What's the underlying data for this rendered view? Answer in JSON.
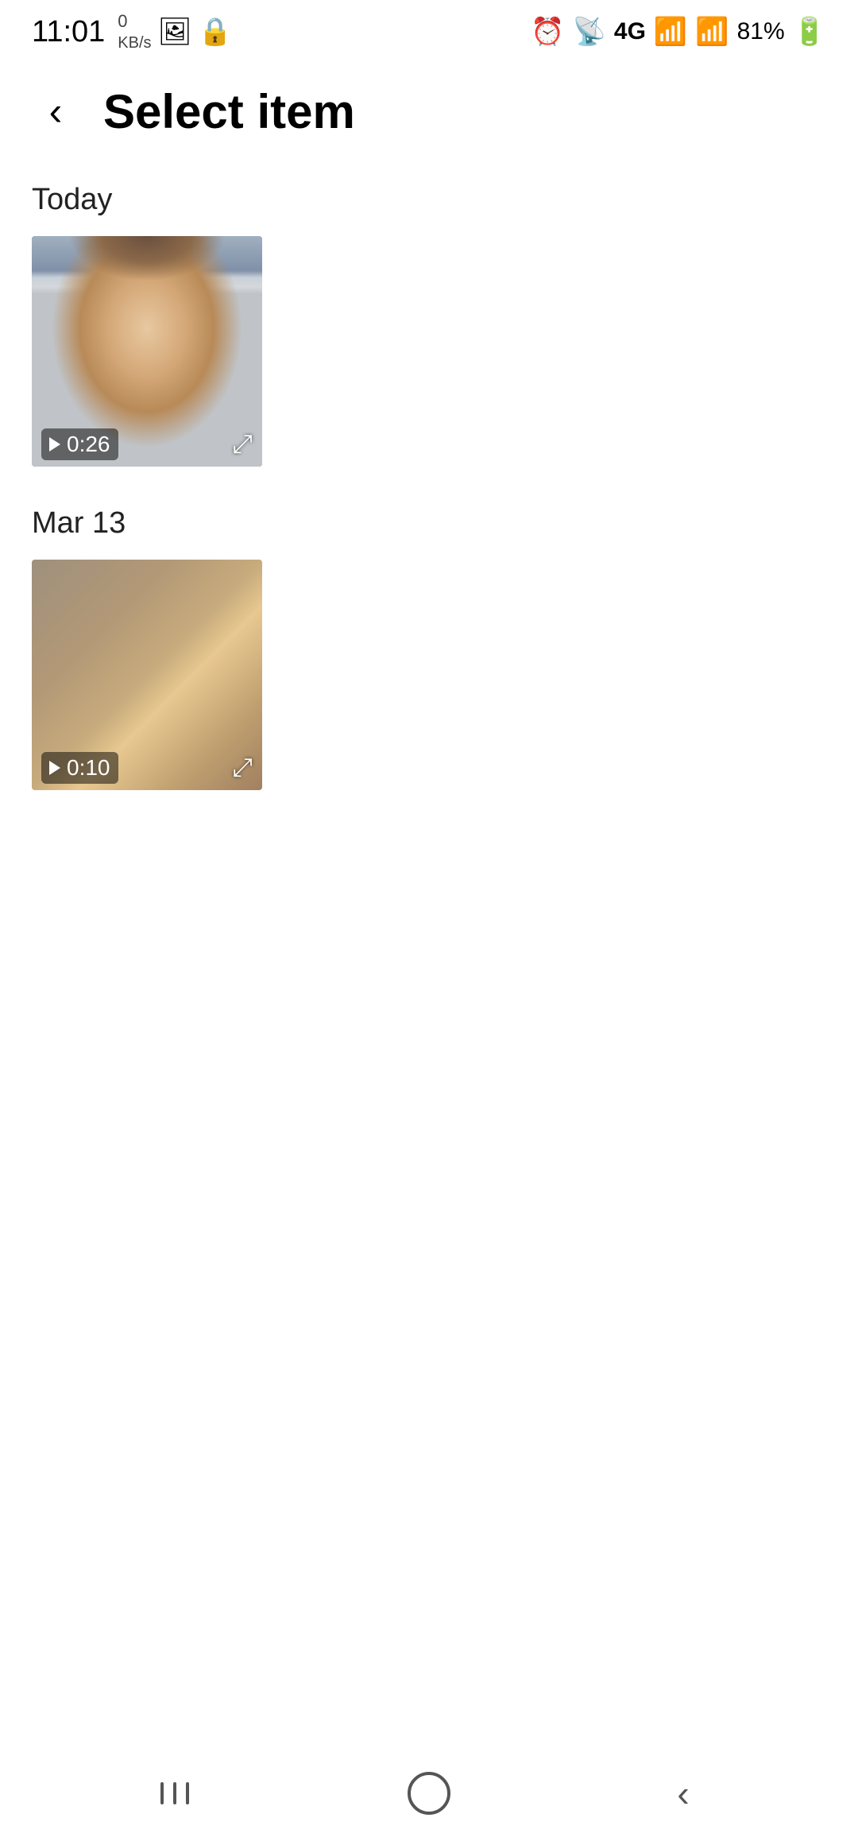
{
  "statusBar": {
    "time": "11:01",
    "leftIcons": [
      "0 KB/s",
      "📷",
      "🔒"
    ],
    "rightIcons": [
      "⏰",
      "📡",
      "4G",
      "81%"
    ]
  },
  "header": {
    "backLabel": "‹",
    "title": "Select item"
  },
  "sections": [
    {
      "id": "today",
      "label": "Today",
      "items": [
        {
          "id": "video-1",
          "type": "video",
          "duration": "0:26",
          "thumbClass": "thumb-man"
        }
      ]
    },
    {
      "id": "mar13",
      "label": "Mar 13",
      "items": [
        {
          "id": "video-2",
          "type": "video",
          "duration": "0:10",
          "thumbClass": "thumb-cat"
        }
      ]
    }
  ],
  "navBar": {
    "recentLabel": "recent",
    "homeLabel": "home",
    "backLabel": "back"
  }
}
